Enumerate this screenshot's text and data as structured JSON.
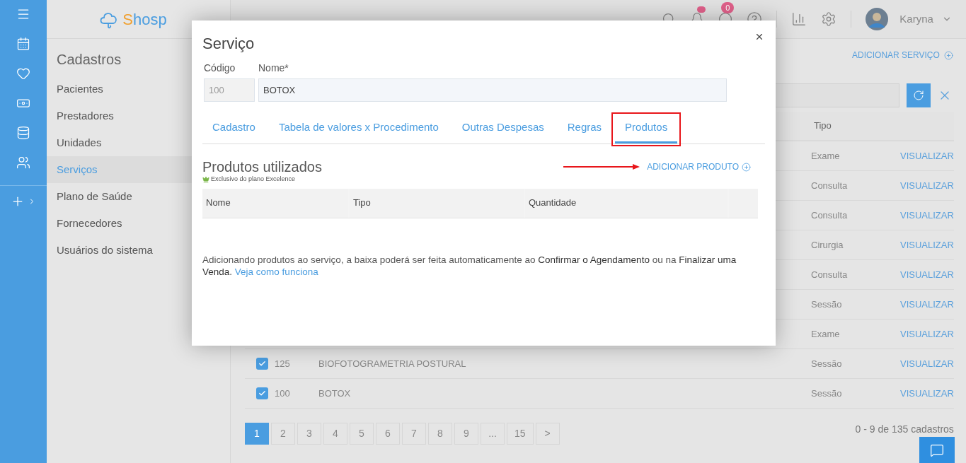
{
  "logo": {
    "accent": "S",
    "rest": "hosp"
  },
  "nav": {
    "title": "Cadastros",
    "items": [
      {
        "label": "Pacientes",
        "selected": false
      },
      {
        "label": "Prestadores",
        "selected": false
      },
      {
        "label": "Unidades",
        "selected": false
      },
      {
        "label": "Serviços",
        "selected": true
      },
      {
        "label": "Plano de Saúde",
        "selected": false
      },
      {
        "label": "Fornecedores",
        "selected": false
      },
      {
        "label": "Usuários do sistema",
        "selected": false
      }
    ]
  },
  "header": {
    "chat_badge": "0",
    "user": "Karyna"
  },
  "page": {
    "add_button": "ADICIONAR SERVIÇO",
    "table": {
      "columns": [
        "Tipo"
      ],
      "rows": [
        {
          "type": "Exame",
          "action": "VISUALIZAR"
        },
        {
          "type": "Consulta",
          "action": "VISUALIZAR"
        },
        {
          "type": "Consulta",
          "action": "VISUALIZAR"
        },
        {
          "type": "Cirurgia",
          "action": "VISUALIZAR"
        },
        {
          "type": "Consulta",
          "action": "VISUALIZAR"
        },
        {
          "type": "Sessão",
          "action": "VISUALIZAR"
        },
        {
          "type": "Exame",
          "action": "VISUALIZAR"
        },
        {
          "checked": true,
          "code": "125",
          "name": "BIOFOTOGRAMETRIA POSTURAL",
          "type": "Sessão",
          "action": "VISUALIZAR"
        },
        {
          "checked": true,
          "code": "100",
          "name": "BOTOX",
          "type": "Sessão",
          "action": "VISUALIZAR"
        }
      ]
    },
    "pagination": [
      {
        "label": "1",
        "selected": true
      },
      {
        "label": "2",
        "selected": false
      },
      {
        "label": "3",
        "selected": false
      },
      {
        "label": "4",
        "selected": false
      },
      {
        "label": "5",
        "selected": false
      },
      {
        "label": "6",
        "selected": false
      },
      {
        "label": "7",
        "selected": false
      },
      {
        "label": "8",
        "selected": false
      },
      {
        "label": "9",
        "selected": false
      },
      {
        "label": "...",
        "selected": false
      },
      {
        "label": "15",
        "selected": false
      },
      {
        "label": ">",
        "selected": false
      }
    ],
    "summary": "0 - 9 de 135 cadastros"
  },
  "modal": {
    "title": "Serviço",
    "fields": [
      {
        "label": "Código",
        "value": "100",
        "disabled": true
      },
      {
        "label": "Nome*",
        "value": "BOTOX",
        "disabled": false
      }
    ],
    "tabs": [
      {
        "label": "Cadastro",
        "selected": false
      },
      {
        "label": "Tabela de valores x Procedimento",
        "selected": false
      },
      {
        "label": "Outras Despesas",
        "selected": false
      },
      {
        "label": "Regras",
        "selected": false
      },
      {
        "label": "Produtos",
        "selected": true
      }
    ],
    "section": {
      "title": "Produtos utilizados",
      "plan_note": "Exclusivo do plano Excelence",
      "add_button": "ADICIONAR PRODUTO",
      "columns": [
        "Nome",
        "Tipo",
        "Quantidade"
      ],
      "info": {
        "text": "Adicionando produtos ao serviço, a baixa poderá ser feita automaticamente ao **Confirmar o Agendamento** ou na **Finalizar uma Venda**.",
        "link": "Veja como funciona"
      }
    },
    "annotations": {
      "frame_selected_tab": true,
      "arrow_to_add_button": true
    }
  }
}
